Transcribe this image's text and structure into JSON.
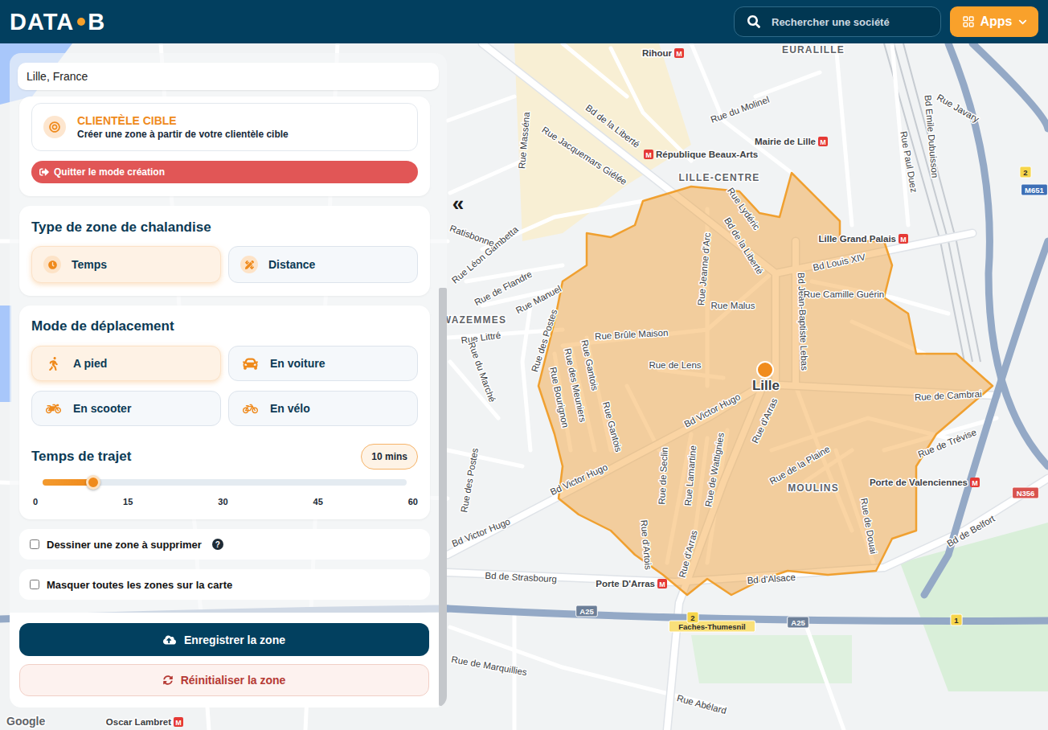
{
  "header": {
    "logo_left": "DATA",
    "logo_right": "B",
    "search": {
      "placeholder": "Rechercher une société"
    },
    "apps_button": {
      "label": "Apps"
    }
  },
  "panel": {
    "location_field": {
      "value": "Lille, France"
    },
    "target_card": {
      "title": "CLIENTÈLE CIBLE",
      "subtitle": "Créer une zone à partir de votre clientèle cible"
    },
    "quit_button": {
      "label": "Quitter le mode création"
    },
    "zone_type": {
      "title": "Type de zone de chalandise",
      "options": [
        {
          "label": "Temps",
          "selected": true
        },
        {
          "label": "Distance",
          "selected": false
        }
      ]
    },
    "travel_mode": {
      "title": "Mode de déplacement",
      "options": [
        {
          "label": "A pied",
          "selected": true
        },
        {
          "label": "En voiture",
          "selected": false
        },
        {
          "label": "En scooter",
          "selected": false
        },
        {
          "label": "En vélo",
          "selected": false
        }
      ]
    },
    "travel_time": {
      "title": "Temps de trajet",
      "reading": "10 mins",
      "level": 0.14,
      "ticks": [
        "0",
        "15",
        "30",
        "45",
        "60"
      ]
    },
    "checkboxes": [
      {
        "label": "Dessiner une zone à supprimer",
        "checked": false,
        "help": "?"
      },
      {
        "label": "Masquer toutes les zones sur la carte",
        "checked": false,
        "help": ""
      }
    ],
    "save_button": {
      "label": "Enregistrer la zone"
    },
    "reset_button": {
      "label": "Réinitialiser la zone"
    }
  },
  "collapse_button": {
    "label": "«"
  },
  "map": {
    "metro_symbol": "M",
    "attribution": "Google",
    "pin": {
      "label": "Lille"
    },
    "labels": [
      {
        "text": "Rihour",
        "kind": "station"
      },
      {
        "text": "EURALILLE",
        "kind": "district"
      },
      {
        "text": "Bd de la Liberté",
        "kind": "street"
      },
      {
        "text": "Rue Jacquemars Giélée",
        "kind": "street"
      },
      {
        "text": "Rue Masséna",
        "kind": "street"
      },
      {
        "text": "République Beaux-Arts",
        "kind": "station"
      },
      {
        "text": "Rue du Molinel",
        "kind": "street"
      },
      {
        "text": "Mairie de Lille",
        "kind": "station"
      },
      {
        "text": "LILLE-CENTRE",
        "kind": "district"
      },
      {
        "text": "Rue Lydéric",
        "kind": "street"
      },
      {
        "text": "Bd de la Liberté",
        "kind": "street"
      },
      {
        "text": "Rue Jeanne d'Arc",
        "kind": "street"
      },
      {
        "text": "Lille Grand Palais",
        "kind": "station"
      },
      {
        "text": "Bd Louis XIV",
        "kind": "street"
      },
      {
        "text": "Bd Jean-Baptiste Lebas",
        "kind": "street"
      },
      {
        "text": "Rue Camille Guérin",
        "kind": "street"
      },
      {
        "text": "Rue Malus",
        "kind": "street"
      },
      {
        "text": "Rue Brûle Maison",
        "kind": "street"
      },
      {
        "text": "Rue de Lens",
        "kind": "street"
      },
      {
        "text": "Rue de Cambrai",
        "kind": "street"
      },
      {
        "text": "Rue de Trévise",
        "kind": "street"
      },
      {
        "text": "Porte de Valenciennes",
        "kind": "station"
      },
      {
        "text": "MOULINS",
        "kind": "district"
      },
      {
        "text": "Rue de la Plaine",
        "kind": "street"
      },
      {
        "text": "Rue de Douai",
        "kind": "street"
      },
      {
        "text": "Bd Victor Hugo",
        "kind": "street"
      },
      {
        "text": "Rue d'Arras",
        "kind": "street"
      },
      {
        "text": "Rue d'Arras",
        "kind": "street"
      },
      {
        "text": "Rue de Wattignies",
        "kind": "street"
      },
      {
        "text": "Rue Lamartine",
        "kind": "street"
      },
      {
        "text": "Rue de Seclin",
        "kind": "street"
      },
      {
        "text": "Rue Gantois",
        "kind": "street"
      },
      {
        "text": "Rue Gantois",
        "kind": "street"
      },
      {
        "text": "Rue des Meuniers",
        "kind": "street"
      },
      {
        "text": "Rue Bourignon",
        "kind": "street"
      },
      {
        "text": "Rue des Postes",
        "kind": "street"
      },
      {
        "text": "Rue d'Artois",
        "kind": "street"
      },
      {
        "text": "Bd Victor Hugo",
        "kind": "street"
      },
      {
        "text": "Bd Victor Hugo",
        "kind": "street"
      },
      {
        "text": "Rue des Postes",
        "kind": "street"
      },
      {
        "text": "WAZEMMES",
        "kind": "district"
      },
      {
        "text": "Rue Littré",
        "kind": "street"
      },
      {
        "text": "Rue du Marché",
        "kind": "street"
      },
      {
        "text": "Rue Léon Gambetta",
        "kind": "street"
      },
      {
        "text": "Ratisbonne",
        "kind": "street"
      },
      {
        "text": "Rue de Flandre",
        "kind": "street"
      },
      {
        "text": "Rue Manuel",
        "kind": "street"
      },
      {
        "text": "Bd de Strasbourg",
        "kind": "street"
      },
      {
        "text": "Porte D'Arras",
        "kind": "station"
      },
      {
        "text": "Bd d'Alsace",
        "kind": "street"
      },
      {
        "text": "Rue de Marquillies",
        "kind": "street"
      },
      {
        "text": "Rue Abélard",
        "kind": "street"
      },
      {
        "text": "Bd de Belfort",
        "kind": "street"
      },
      {
        "text": "Rue Javary",
        "kind": "street"
      },
      {
        "text": "Bd Emile Dubuisson",
        "kind": "street"
      },
      {
        "text": "Rue Paul Duez",
        "kind": "street"
      },
      {
        "text": "Oscar Lambret",
        "kind": "station"
      }
    ],
    "road_shields": [
      {
        "text": "A25",
        "kind": "autoroute"
      },
      {
        "text": "A25",
        "kind": "autoroute"
      },
      {
        "text": "Faches-Thumesnil",
        "kind": "exit-name"
      },
      {
        "text": "N356",
        "kind": "nationale"
      },
      {
        "text": "M651",
        "kind": "metropole"
      },
      {
        "text": "2",
        "kind": "exit"
      },
      {
        "text": "2",
        "kind": "exit"
      },
      {
        "text": "1",
        "kind": "exit"
      }
    ]
  }
}
